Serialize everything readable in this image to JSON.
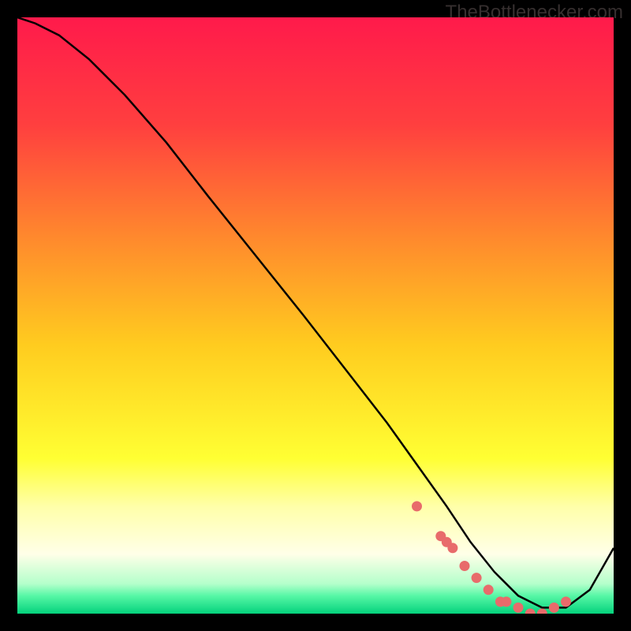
{
  "watermark": "TheBottlenecker.com",
  "chart_data": {
    "type": "line",
    "title": "",
    "xlabel": "",
    "ylabel": "",
    "xlim": [
      0,
      100
    ],
    "ylim": [
      0,
      100
    ],
    "grid": false,
    "legend": false,
    "background_gradient": {
      "stops": [
        {
          "pos": 0.0,
          "color": "#ff1a4b"
        },
        {
          "pos": 0.18,
          "color": "#ff3f3f"
        },
        {
          "pos": 0.38,
          "color": "#ff8d2c"
        },
        {
          "pos": 0.55,
          "color": "#ffcc1f"
        },
        {
          "pos": 0.74,
          "color": "#ffff33"
        },
        {
          "pos": 0.82,
          "color": "#ffffa9"
        },
        {
          "pos": 0.9,
          "color": "#ffffe8"
        },
        {
          "pos": 0.95,
          "color": "#b4ffcb"
        },
        {
          "pos": 0.97,
          "color": "#57f7a6"
        },
        {
          "pos": 1.0,
          "color": "#04d27c"
        }
      ]
    },
    "series": [
      {
        "name": "curve",
        "color": "#000000",
        "x": [
          0,
          3,
          7,
          12,
          18,
          25,
          32,
          40,
          48,
          55,
          62,
          67,
          72,
          76,
          80,
          84,
          88,
          92,
          96,
          100
        ],
        "y": [
          100,
          99,
          97,
          93,
          87,
          79,
          70,
          60,
          50,
          41,
          32,
          25,
          18,
          12,
          7,
          3,
          1,
          1,
          4,
          11
        ]
      }
    ],
    "markers": {
      "name": "fit-points",
      "color": "#e86b6b",
      "shape": "circle",
      "x": [
        67,
        71,
        72,
        73,
        75,
        77,
        79,
        81,
        82,
        84,
        86,
        88,
        90,
        92
      ],
      "y": [
        18,
        13,
        12,
        11,
        8,
        6,
        4,
        2,
        2,
        1,
        0,
        0,
        1,
        2
      ]
    }
  }
}
